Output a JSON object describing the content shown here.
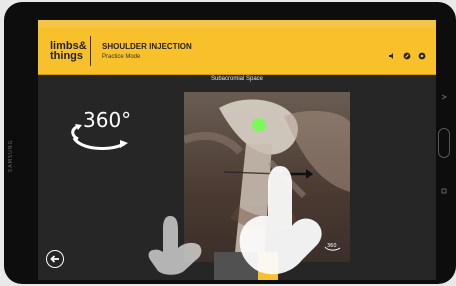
{
  "device": {
    "brand": "SAMSUNG"
  },
  "app": {
    "logo_line1": "limbs&",
    "logo_line2": "things",
    "title": "SHOULDER INJECTION",
    "subtitle": "Practice Mode",
    "caption": "Subacromial Space",
    "rotate_text": "360°",
    "mini_rotate_text": "360"
  },
  "colors": {
    "accent": "#f8c12c",
    "bg": "#262626"
  },
  "icons": {
    "header": [
      "speaker-icon",
      "link-icon",
      "settings-icon"
    ],
    "back": "back-arrow-icon"
  }
}
